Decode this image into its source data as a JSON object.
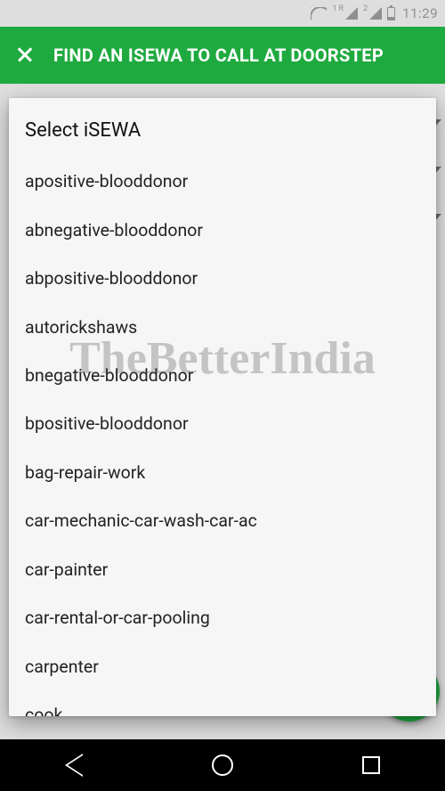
{
  "statusbar": {
    "signal1_label": "1",
    "signal1_sup": "R",
    "signal2_label": "2",
    "time": "11:29"
  },
  "appbar": {
    "title": "FIND AN ISEWA TO CALL AT DOORSTEP"
  },
  "dropdown": {
    "header": "Select iSEWA",
    "items": [
      "apositive-blooddonor",
      "abnegative-blooddonor",
      "abpositive-blooddonor",
      "autorickshaws",
      "bnegative-blooddonor",
      "bpositive-blooddonor",
      "bag-repair-work",
      "car-mechanic-car-wash-car-ac",
      "car-painter",
      "car-rental-or-car-pooling",
      "carpenter",
      "cook"
    ]
  },
  "watermark": "TheBetterIndia"
}
